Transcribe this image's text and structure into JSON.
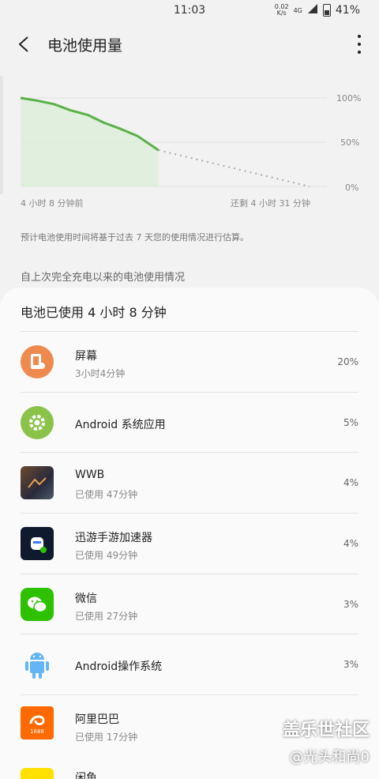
{
  "status": {
    "time": "11:03",
    "speed_value": "0.02",
    "speed_unit": "K/s",
    "network": "4G",
    "battery": "41%"
  },
  "header": {
    "title": "电池使用量"
  },
  "chart": {
    "y_labels": [
      "100%",
      "50%",
      "0%"
    ],
    "x_left": "4 小时 8 分钟前",
    "x_right": "还剩 4 小时 31 分钟",
    "line_color": "#59b248",
    "fill_color": "#dcefd8"
  },
  "chart_data": {
    "type": "line",
    "title": "",
    "ylim": [
      0,
      100
    ],
    "y_ticks": [
      "100%",
      "50%",
      "0%"
    ],
    "x_start_label": "4 小时 8 分钟前",
    "x_end_label": "还剩 4 小时 31 分钟",
    "series": [
      {
        "name": "",
        "x": [
          0,
          0.5,
          1,
          1.5,
          2,
          2.5,
          3,
          3.5,
          4.13
        ],
        "values": [
          100,
          97,
          93,
          86,
          81,
          72,
          65,
          57,
          41
        ]
      },
      {
        "name": "",
        "style": "dashed",
        "x": [
          4.13,
          8.65
        ],
        "values": [
          41,
          0
        ]
      }
    ]
  },
  "note": "预计电池使用时间将基于过去 7 天您的使用情况进行估算。",
  "section_title": "自上次完全充电以来的电池使用情况",
  "card": {
    "title": "电池已使用 4 小时 8 分钟",
    "items": [
      {
        "name": "屏幕",
        "sub": "3小时4分钟",
        "percent": "20%",
        "icon": "screen-icon",
        "color": "#ef8a4e"
      },
      {
        "name": "Android 系统应用",
        "sub": "",
        "percent": "5%",
        "icon": "gear-icon",
        "color": "#8bc34a"
      },
      {
        "name": "WWB",
        "sub": "已使用 47分钟",
        "percent": "4%",
        "icon": "game-icon",
        "color": "#4a3b30"
      },
      {
        "name": "迅游手游加速器",
        "sub": "已使用 49分钟",
        "percent": "4%",
        "icon": "robot-icon",
        "color": "#101a2e"
      },
      {
        "name": "微信",
        "sub": "已使用 27分钟",
        "percent": "3%",
        "icon": "wechat-icon",
        "color": "#2dc100"
      },
      {
        "name": "Android操作系统",
        "sub": "",
        "percent": "3%",
        "icon": "android-icon",
        "color": "#64b5f6"
      },
      {
        "name": "阿里巴巴",
        "sub": "已使用 17分钟",
        "percent": "",
        "icon": "alibaba-icon",
        "color": "#ff6a00",
        "badge": "1688"
      },
      {
        "name": "闲鱼",
        "sub": "",
        "percent": "",
        "icon": "xianyu-icon",
        "color": "#ffe000"
      }
    ]
  },
  "watermark": {
    "line1": "盖乐世社区",
    "line2": "@光头和尚0"
  }
}
